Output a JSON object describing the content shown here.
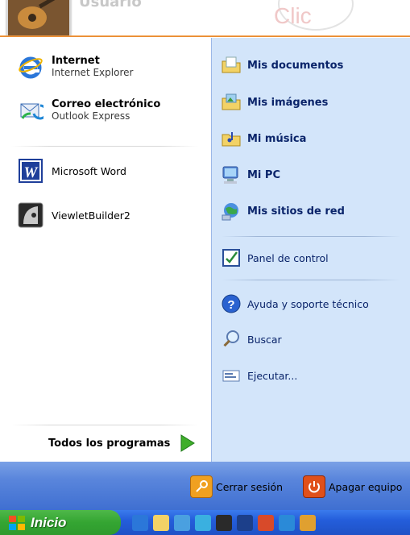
{
  "header": {
    "user_name": "Usuario",
    "watermark": "Clic"
  },
  "left": {
    "pinned": [
      {
        "title": "Internet",
        "subtitle": "Internet Explorer",
        "icon": "internet-explorer-icon"
      },
      {
        "title": "Correo electrónico",
        "subtitle": "Outlook Express",
        "icon": "outlook-express-icon"
      }
    ],
    "recent": [
      {
        "label": "Microsoft Word",
        "icon": "word-icon"
      },
      {
        "label": "ViewletBuilder2",
        "icon": "viewletbuilder-icon"
      }
    ],
    "all_programs": "Todos los programas"
  },
  "right": {
    "bold_items": [
      {
        "label": "Mis documentos",
        "icon": "my-documents-icon"
      },
      {
        "label": "Mis imágenes",
        "icon": "my-pictures-icon"
      },
      {
        "label": "Mi música",
        "icon": "my-music-icon"
      },
      {
        "label": "Mi PC",
        "icon": "my-computer-icon"
      },
      {
        "label": "Mis sitios de red",
        "icon": "network-places-icon"
      }
    ],
    "control_panel": "Panel de control",
    "help": "Ayuda y soporte técnico",
    "search": "Buscar",
    "run": "Ejecutar..."
  },
  "bottom": {
    "logoff": "Cerrar sesión",
    "shutdown": "Apagar equipo"
  },
  "taskbar": {
    "start": "Inicio"
  },
  "colors": {
    "right_panel": "#d3e5fa",
    "link_text": "#0a246a",
    "start_green": "#34a532",
    "taskbar_blue": "#245edb",
    "bottom_bar": "#5a86dc"
  }
}
